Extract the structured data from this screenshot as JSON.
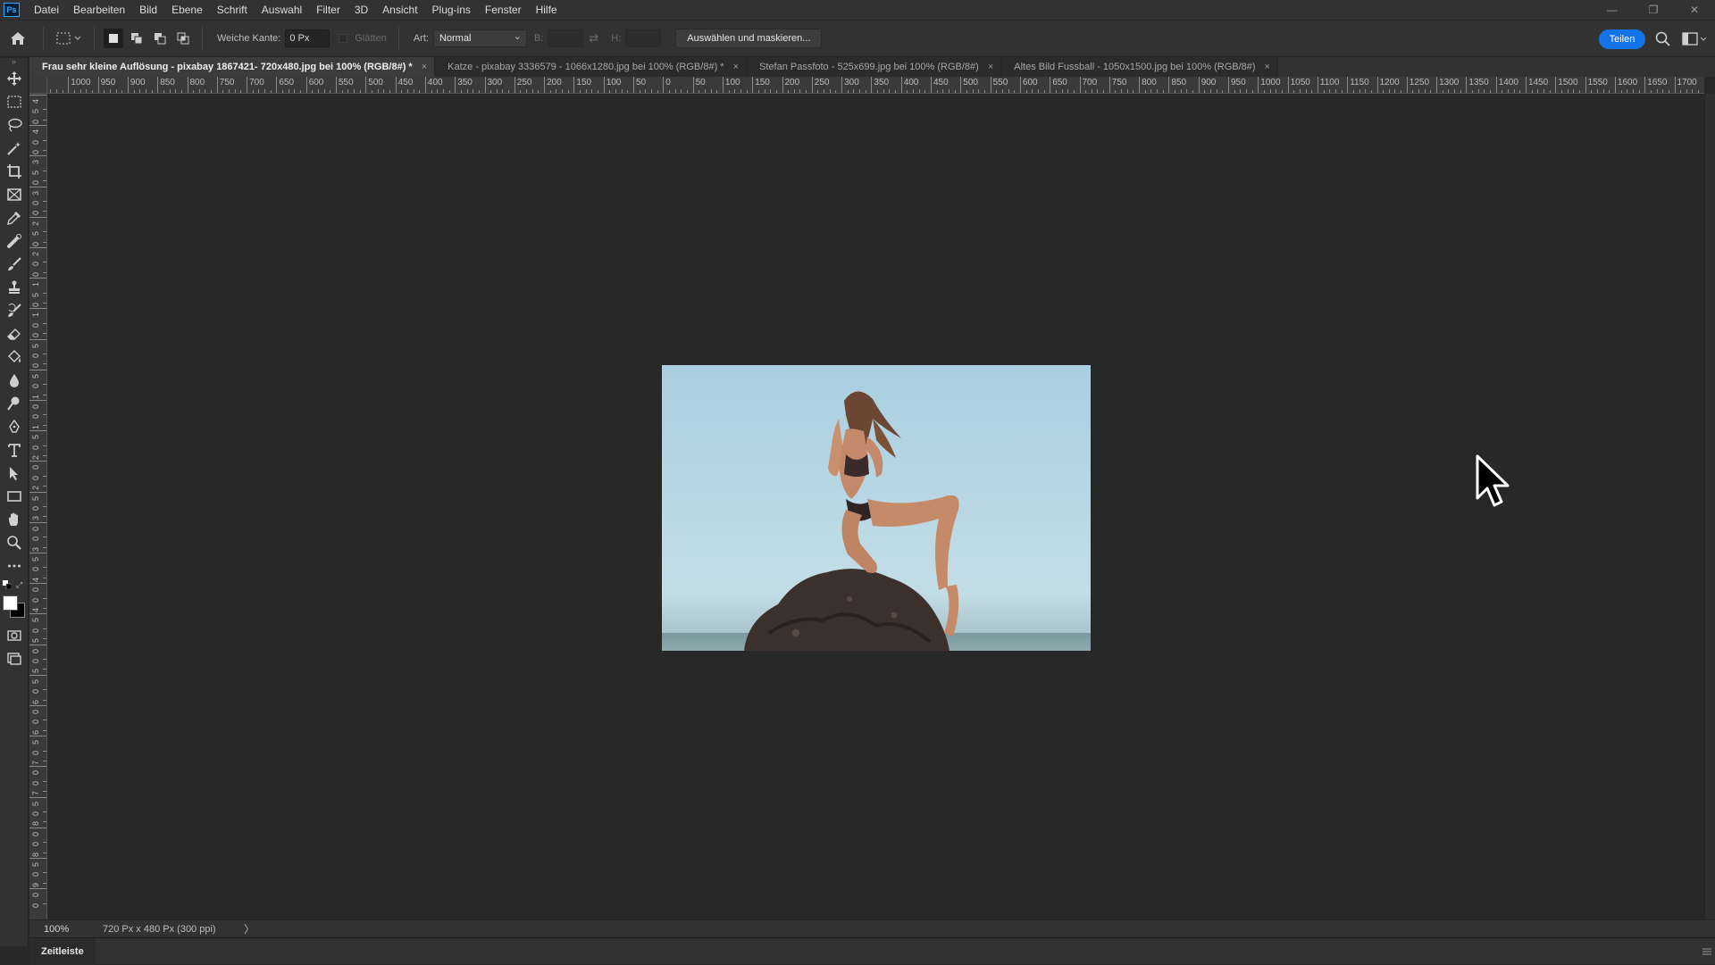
{
  "app": {
    "logo_text": "Ps"
  },
  "menu": [
    "Datei",
    "Bearbeiten",
    "Bild",
    "Ebene",
    "Schrift",
    "Auswahl",
    "Filter",
    "3D",
    "Ansicht",
    "Plug-ins",
    "Fenster",
    "Hilfe"
  ],
  "window_controls": {
    "minimize": "—",
    "restore": "❐",
    "close": "✕"
  },
  "options": {
    "feather_label": "Weiche Kante:",
    "feather_value": "0 Px",
    "antialias_label": "Glätten",
    "style_label": "Art:",
    "style_value": "Normal",
    "width_label": "B:",
    "height_label": "H:",
    "mask_button": "Auswählen und maskieren...",
    "share_button": "Teilen"
  },
  "tabs": [
    {
      "label": "Frau sehr kleine Auflösung - pixabay 1867421- 720x480.jpg bei 100% (RGB/8#) *",
      "active": true
    },
    {
      "label": "Katze - pixabay 3336579 - 1066x1280.jpg bei 100% (RGB/8#) *",
      "active": false
    },
    {
      "label": "Stefan Passfoto - 525x699.jpg bei 100% (RGB/8#)",
      "active": false
    },
    {
      "label": "Altes Bild Fussball - 1050x1500.jpg bei 100% (RGB/8#)",
      "active": false
    }
  ],
  "ruler_top_labels": [
    "0",
    "1000",
    "950",
    "900",
    "850",
    "800",
    "750",
    "700",
    "650",
    "600",
    "550",
    "500",
    "450",
    "400",
    "350",
    "300",
    "250",
    "200",
    "150",
    "100",
    "50",
    "0",
    "50",
    "100",
    "150",
    "200",
    "250",
    "300",
    "350",
    "400",
    "450",
    "500",
    "550",
    "600",
    "650",
    "700",
    "750",
    "800",
    "850",
    "900",
    "950",
    "1000",
    "1050",
    "1100",
    "1150",
    "1200",
    "1250",
    "1300",
    "1350",
    "1400",
    "1450",
    "1500",
    "1550",
    "1600",
    "1650",
    "1700"
  ],
  "ruler_left_labels": [
    "4",
    "5",
    "0",
    "4",
    "0",
    "0",
    "3",
    "5",
    "0",
    "3",
    "0",
    "0",
    "2",
    "5",
    "0",
    "2",
    "0",
    "0",
    "1",
    "5",
    "0",
    "1",
    "0",
    "0",
    "5",
    "0",
    "0",
    "5",
    "0",
    "1",
    "0",
    "0",
    "1",
    "5",
    "0",
    "2",
    "0",
    "0",
    "2",
    "5",
    "0",
    "3",
    "0",
    "0",
    "3",
    "5",
    "0",
    "4",
    "0",
    "0",
    "4",
    "5",
    "0",
    "5",
    "0",
    "0",
    "5",
    "5",
    "0",
    "6",
    "0",
    "0",
    "6",
    "5",
    "0",
    "7",
    "0",
    "0",
    "7",
    "5",
    "0",
    "8",
    "0",
    "0",
    "8",
    "5",
    "0",
    "9",
    "0",
    "0"
  ],
  "status": {
    "zoom": "100%",
    "doc_info": "720 Px x 480 Px (300 ppi)",
    "arrow": "〉"
  },
  "timeline": {
    "label": "Zeitleiste"
  },
  "colors": {
    "accent": "#1473e6",
    "foreground": "#ffffff",
    "background": "#000000"
  }
}
